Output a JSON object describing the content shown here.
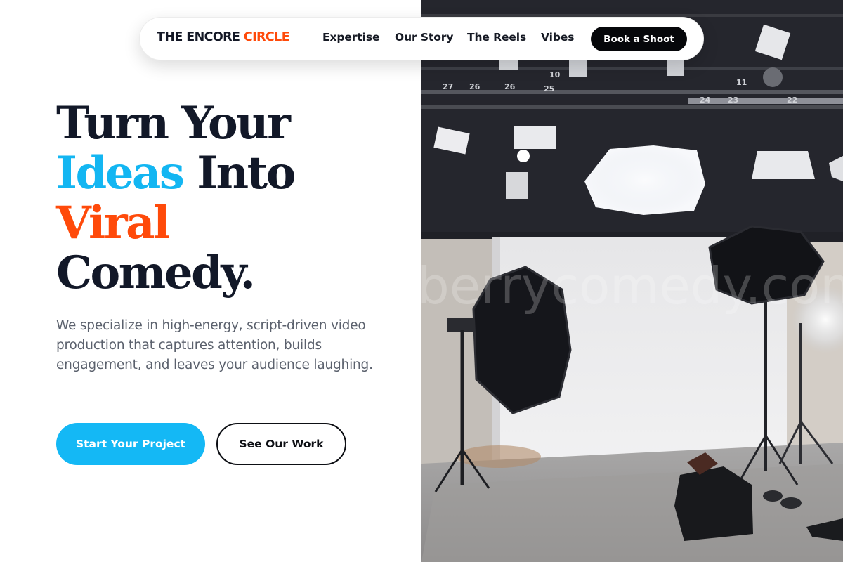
{
  "nav": {
    "brand_main": "THE ENCORE ",
    "brand_accent": "CIRCLE",
    "links": [
      {
        "label": "Expertise"
      },
      {
        "label": "Our Story"
      },
      {
        "label": "The Reels"
      },
      {
        "label": "Vibes"
      }
    ],
    "cta_label": "Book a Shoot"
  },
  "hero": {
    "headline_line1": "Turn Your",
    "headline_highlight1": "Ideas",
    "headline_line2_rest": " Into",
    "headline_highlight2": "Viral",
    "headline_line4": "Comedy.",
    "description": "We specialize in high-energy, script-driven video production that captures attention, builds engagement, and leaves your audience laughing.",
    "primary_button": "Start Your Project",
    "secondary_button": "See Our Work"
  },
  "photo": {
    "watermark": "berrycomedy.com",
    "rig_labels": [
      "10",
      "27",
      "26",
      "26",
      "25",
      "11",
      "24",
      "23",
      "22"
    ]
  },
  "colors": {
    "accent_blue": "#13b6f2",
    "accent_orange": "#ff4a0a",
    "dark": "#121828",
    "cta_dark": "#06070a"
  },
  "icons": [
    "studio-light-icon",
    "softbox-icon"
  ]
}
